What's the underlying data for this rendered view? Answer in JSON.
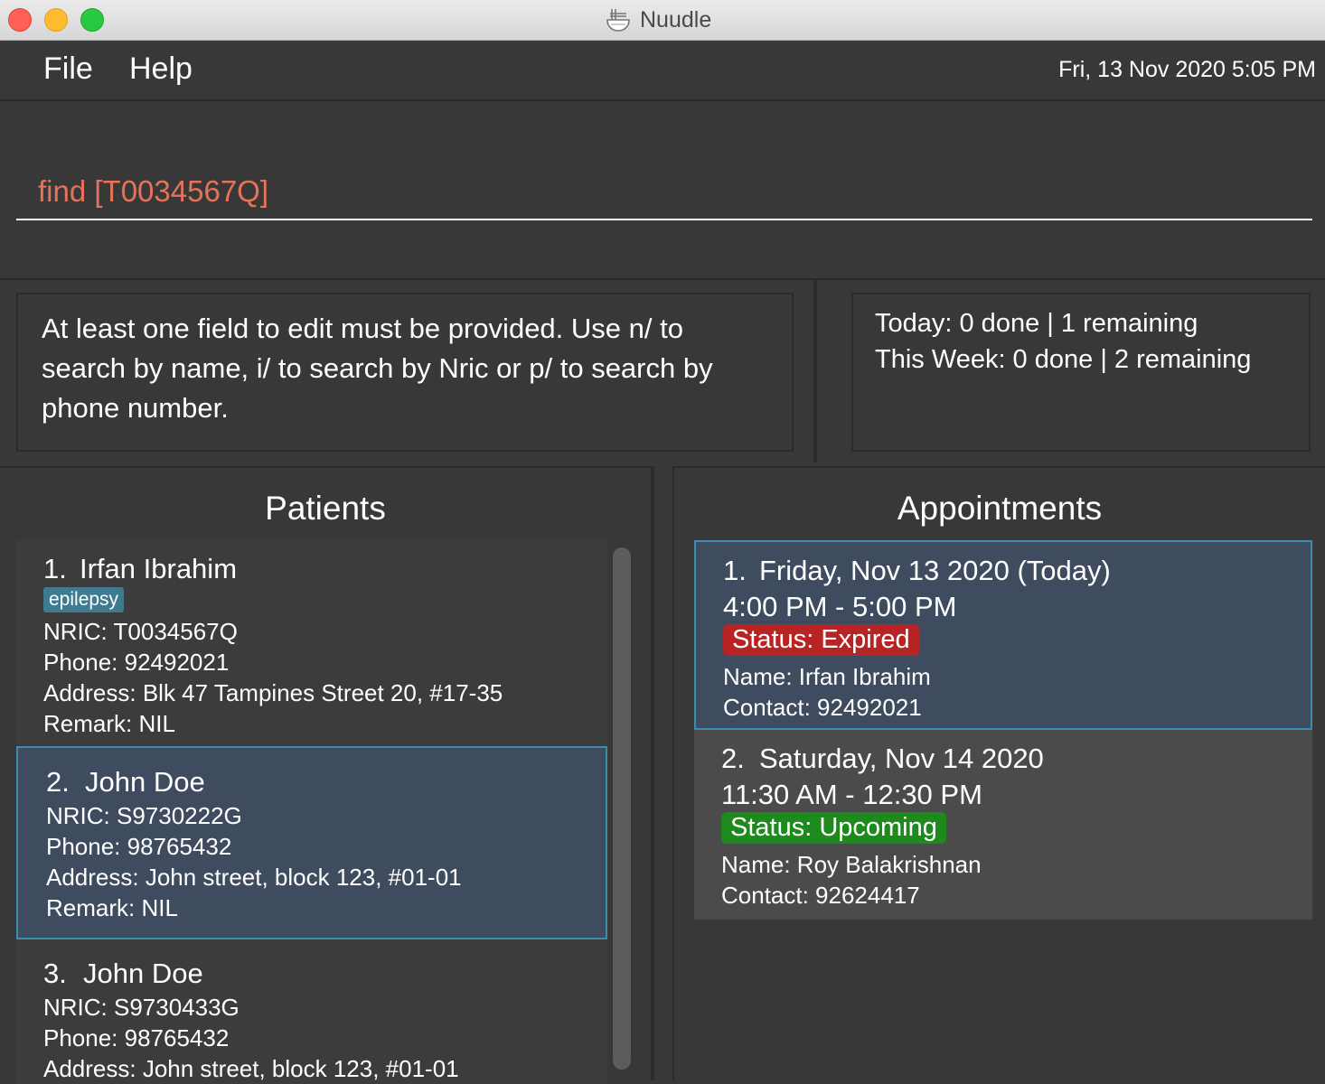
{
  "window": {
    "title": "Nuudle"
  },
  "menu": {
    "file": "File",
    "help": "Help"
  },
  "datetime": "Fri, 13 Nov 2020 5:05 PM",
  "command": {
    "value": "find [T0034567Q]"
  },
  "result": {
    "text": "At least one field to edit must be provided. Use n/ to search by name, i/ to search by Nric or p/ to search by phone number."
  },
  "stats": {
    "today": "Today: 0 done | 1 remaining",
    "week": "This Week: 0 done | 2 remaining"
  },
  "patients": {
    "title": "Patients",
    "items": [
      {
        "index": "1.",
        "name": "Irfan Ibrahim",
        "tag": "epilepsy",
        "nric": "NRIC: T0034567Q",
        "phone": "Phone: 92492021",
        "address": "Address: Blk 47 Tampines Street 20, #17-35",
        "remark": "Remark: NIL"
      },
      {
        "index": "2.",
        "name": "John Doe",
        "nric": "NRIC: S9730222G",
        "phone": "Phone: 98765432",
        "address": "Address: John street, block 123, #01-01",
        "remark": "Remark: NIL"
      },
      {
        "index": "3.",
        "name": "John Doe",
        "nric": "NRIC: S9730433G",
        "phone": "Phone: 98765432",
        "address": "Address: John street, block 123, #01-01"
      }
    ]
  },
  "appointments": {
    "title": "Appointments",
    "items": [
      {
        "index": "1.",
        "date": "Friday, Nov 13 2020 (Today)",
        "time": "4:00 PM - 5:00 PM",
        "status": "Status: Expired",
        "status_color": "#b82424",
        "name": "Name: Irfan Ibrahim",
        "contact": "Contact: 92492021"
      },
      {
        "index": "2.",
        "date": "Saturday, Nov 14 2020",
        "time": "11:30 AM - 12:30 PM",
        "status": "Status: Upcoming",
        "status_color": "#1e8a1e",
        "name": "Name: Roy Balakrishnan",
        "contact": "Contact: 92624417"
      }
    ]
  },
  "colors": {
    "background": "#383838",
    "selected_card": "#3f4b5e",
    "selected_border": "#3c8bb0",
    "command_text": "#e5735a",
    "tag": "#3e7b91"
  }
}
